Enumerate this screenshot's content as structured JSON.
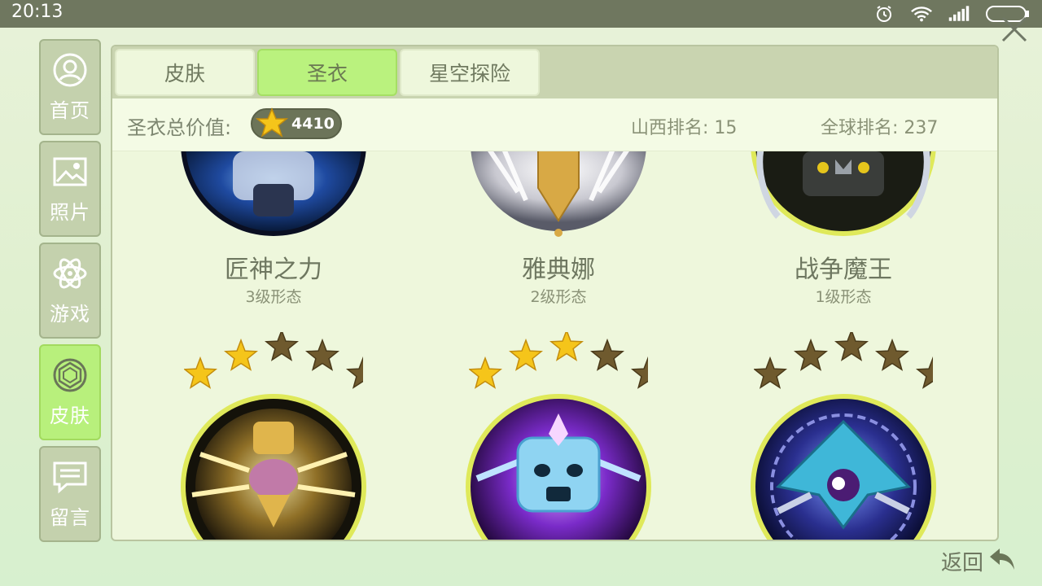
{
  "status": {
    "time": "20:13"
  },
  "sidebar": {
    "items": [
      {
        "label": "首页",
        "icon": "user-icon"
      },
      {
        "label": "照片",
        "icon": "image-icon"
      },
      {
        "label": "游戏",
        "icon": "atom-icon"
      },
      {
        "label": "皮肤",
        "icon": "gem-icon"
      },
      {
        "label": "留言",
        "icon": "message-icon"
      }
    ],
    "active": "皮肤"
  },
  "tabs": [
    {
      "label": "皮肤"
    },
    {
      "label": "圣衣"
    },
    {
      "label": "星空探险"
    }
  ],
  "info": {
    "total_label": "圣衣总价值:",
    "total_value": "4410",
    "province_rank": "山西排名: 15",
    "global_rank": "全球排名: 237"
  },
  "armors_top": [
    {
      "name": "匠神之力",
      "form": "3级形态"
    },
    {
      "name": "雅典娜",
      "form": "2级形态"
    },
    {
      "name": "战争魔王",
      "form": "1级形态"
    }
  ],
  "armors_bottom": [
    {
      "stars_filled": 2,
      "stars_total": 5
    },
    {
      "stars_filled": 3,
      "stars_total": 5
    },
    {
      "stars_filled": 0,
      "stars_total": 5
    }
  ],
  "footer": {
    "back_label": "返回"
  },
  "colors": {
    "accent": "#b8f07c",
    "star_gold": "#f5c51a",
    "star_empty": "#6f5a2e"
  }
}
